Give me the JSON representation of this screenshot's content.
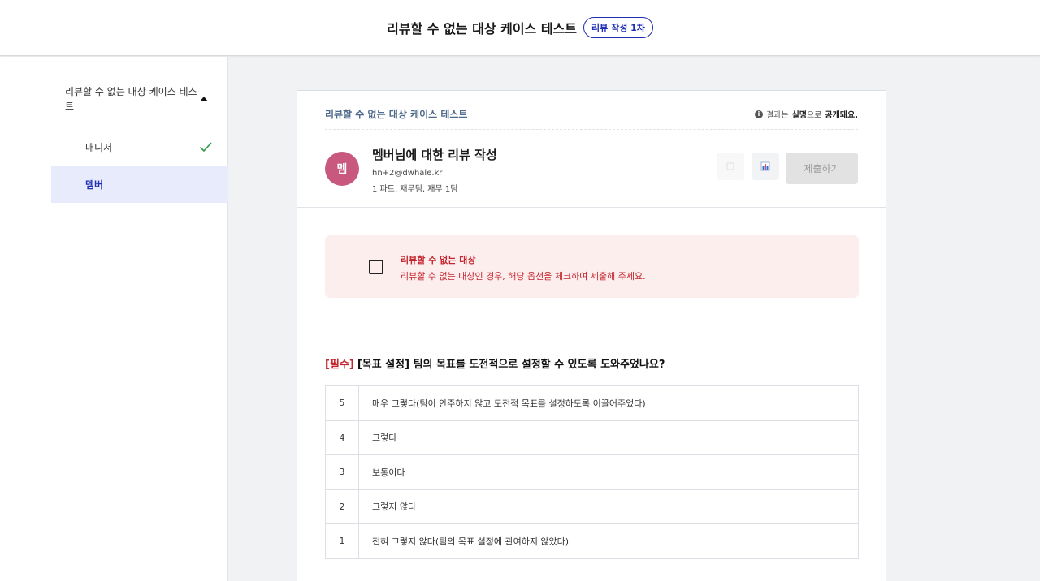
{
  "header": {
    "title": "리뷰할 수 없는 대상 케이스 테스트",
    "badge": "리뷰 작성 1차"
  },
  "sidebar": {
    "group_title": "리뷰할 수 없는 대상 케이스 테스트",
    "items": [
      {
        "label": "매니저",
        "completed": true
      },
      {
        "label": "멤버",
        "selected": true
      }
    ]
  },
  "card": {
    "test_name": "리뷰할 수 없는 대상 케이스 테스트",
    "notice": {
      "prefix": "결과는",
      "bold1": "실명",
      "mid": "으로",
      "bold2": "공개돼요."
    },
    "avatar_text": "멤",
    "reviewee_title": "멤버님에 대한 리뷰 작성",
    "email": "hn+2@dwhale.kr",
    "team": "1 파트, 재무팀, 재무 1팀",
    "submit_label": "제출하기"
  },
  "exclude": {
    "title": "리뷰할 수 없는 대상",
    "description": "리뷰할 수 없는 대상인 경우, 해당 옵션을 체크하여 제출해 주세요."
  },
  "question": {
    "required_tag": "[필수]",
    "text": "[목표 설정] 팀의 목표를 도전적으로 설정할 수 있도록 도와주었나요?",
    "options": [
      {
        "score": "5",
        "label": "매우 그렇다(팀이 안주하지 않고 도전적 목표를 설정하도록 이끌어주었다)"
      },
      {
        "score": "4",
        "label": "그렇다"
      },
      {
        "score": "3",
        "label": "보통이다"
      },
      {
        "score": "2",
        "label": "그렇지 않다"
      },
      {
        "score": "1",
        "label": "전혀 그렇지 않다(팀의 목표 설정에 관여하지 않았다)"
      }
    ]
  },
  "colors": {
    "accent": "#1d2fb5",
    "danger": "#c4252e",
    "avatar": "#c9587e"
  },
  "icons": [
    "caret-up-icon",
    "check-icon",
    "info-icon",
    "chart-icon"
  ]
}
